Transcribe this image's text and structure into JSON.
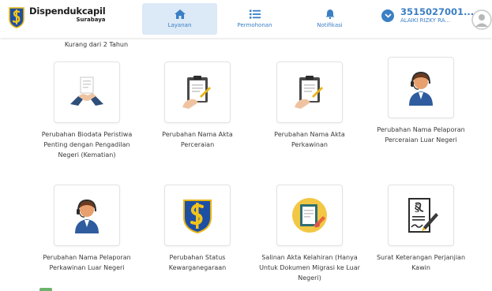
{
  "brand": {
    "title": "Dispendukcapil",
    "subtitle": "Surabaya"
  },
  "nav": [
    {
      "label": "Layanan",
      "icon": "home-icon",
      "active": true
    },
    {
      "label": "Permohonan",
      "icon": "list-icon",
      "active": false
    },
    {
      "label": "Notifikasi",
      "icon": "bell-icon",
      "active": false
    }
  ],
  "account": {
    "id": "3515027001...",
    "name": "ALAIKI RIZKY RA..."
  },
  "top_label": "Kurang dari 2 Tahun",
  "services": [
    {
      "label": "Perubahan Biodata Peristiwa Penting dengan Pengadilan Negeri (Kematian)",
      "icon": "handshake-document-icon"
    },
    {
      "label": "Perubahan Nama Akta Perceraian",
      "icon": "clipboard-document-icon"
    },
    {
      "label": "Perubahan Nama Akta Perkawinan",
      "icon": "clipboard-document-icon"
    },
    {
      "label": "Perubahan Nama Pelaporan Perceraian Luar Negeri",
      "icon": "customer-service-agent-icon"
    },
    {
      "label": "Perubahan Nama Pelaporan Perkawinan Luar Negeri",
      "icon": "customer-service-agent-icon"
    },
    {
      "label": "Perubahan Status Kewarganegaraan",
      "icon": "surabaya-emblem-icon"
    },
    {
      "label": "Salinan Akta Kelahiran (Hanya Untuk Dokumen Migrasi ke Luar Negeri)",
      "icon": "certificate-pencil-icon"
    },
    {
      "label": "Surat Keterangan Perjanjian Kawin",
      "icon": "contract-signing-icon"
    }
  ],
  "colors": {
    "accent": "#3b7fc4",
    "active_tab_bg": "#dce9f7"
  }
}
